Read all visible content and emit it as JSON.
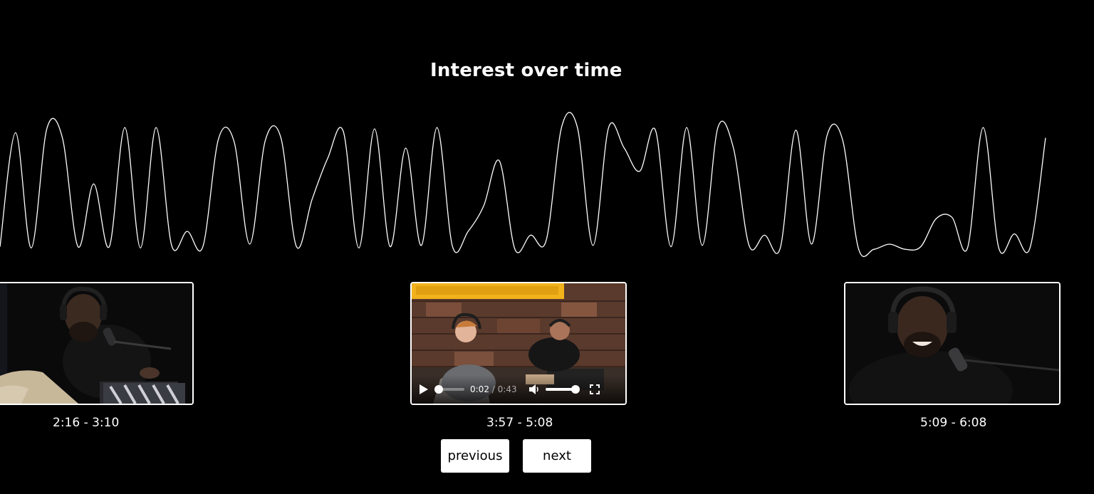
{
  "header": {
    "title": "Interest over time"
  },
  "interest_chart": {
    "line_color": "#ffffff",
    "samples": [
      0.03,
      0.92,
      0.02,
      0.95,
      0.88,
      0.03,
      0.52,
      0.03,
      0.96,
      0.02,
      0.96,
      0.04,
      0.15,
      0.03,
      0.87,
      0.85,
      0.05,
      0.86,
      0.88,
      0.03,
      0.4,
      0.72,
      0.93,
      0.02,
      0.95,
      0.03,
      0.8,
      0.04,
      0.96,
      0.03,
      0.15,
      0.35,
      0.7,
      0.01,
      0.12,
      0.08,
      0.97,
      0.96,
      0.04,
      0.96,
      0.8,
      0.62,
      0.94,
      0.03,
      0.96,
      0.04,
      0.96,
      0.8,
      0.04,
      0.12,
      0.02,
      0.94,
      0.05,
      0.9,
      0.86,
      0.02,
      0.01,
      0.05,
      0.01,
      0.03,
      0.25,
      0.26,
      0.02,
      0.96,
      0.02,
      0.13,
      0.02,
      0.88
    ]
  },
  "clips": [
    {
      "range": "2:16 - 3:10"
    },
    {
      "range": "3:57 - 5:08",
      "player": {
        "current": "0:02",
        "separator": "/",
        "duration": "0:43",
        "progress": 0.05,
        "volume": 1.0
      }
    },
    {
      "range": "5:09 - 6:08"
    }
  ],
  "nav": {
    "previous_label": "previous",
    "next_label": "next"
  }
}
